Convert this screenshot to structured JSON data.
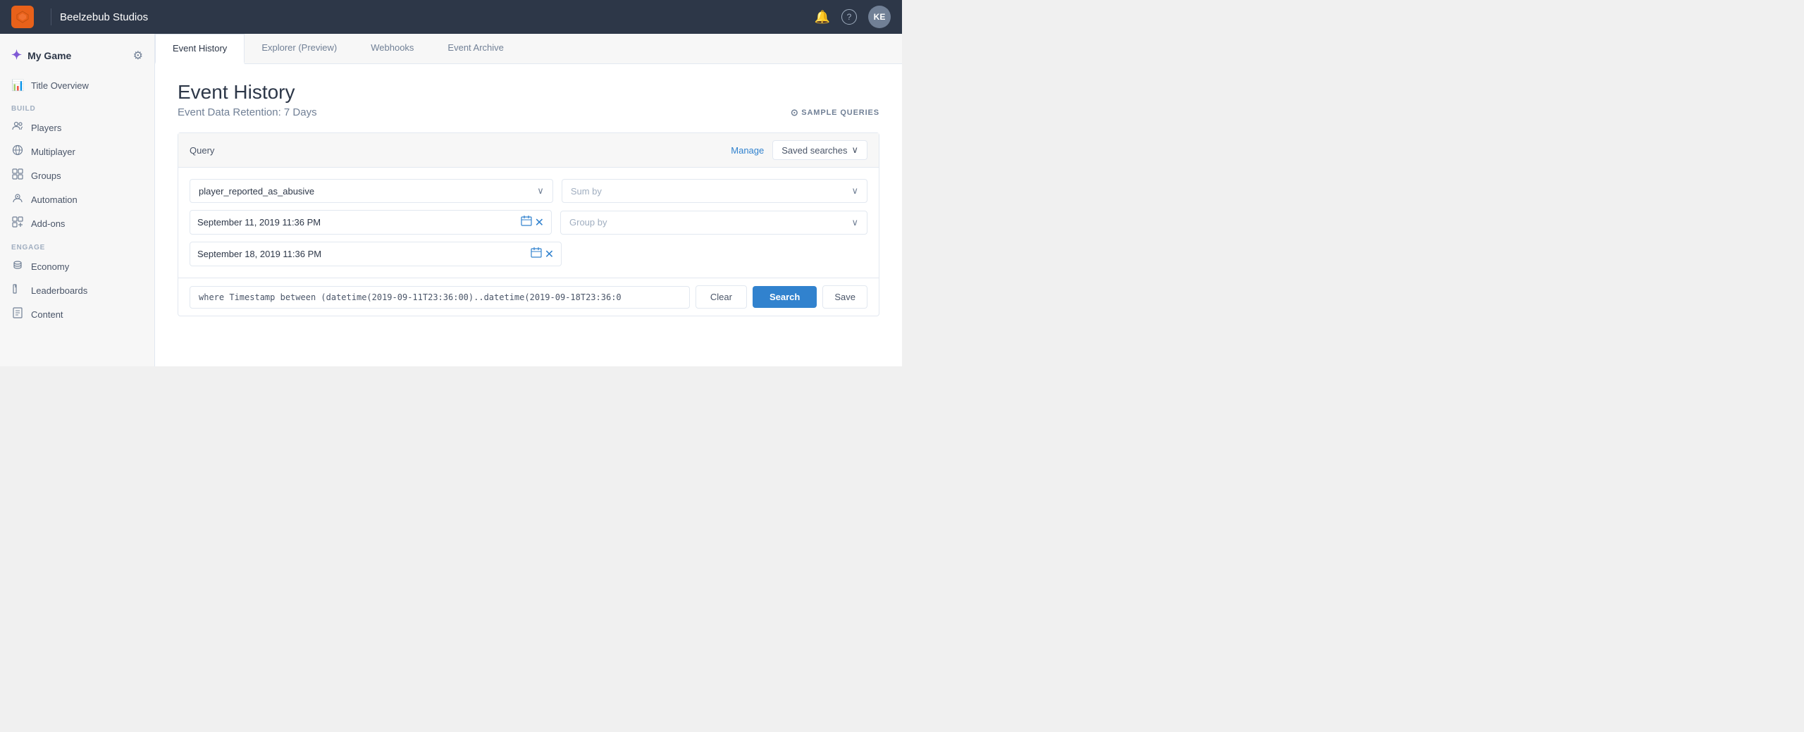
{
  "topnav": {
    "logo_text": "🔥",
    "company_name": "Beelzebub Studios",
    "avatar_initials": "KE",
    "bell_icon": "🔔",
    "help_icon": "?"
  },
  "sidebar": {
    "game_name": "My Game",
    "sections": [
      {
        "label": "",
        "items": [
          {
            "id": "title-overview",
            "label": "Title Overview",
            "icon": "📊"
          }
        ]
      },
      {
        "label": "BUILD",
        "items": [
          {
            "id": "players",
            "label": "Players",
            "icon": "👥"
          },
          {
            "id": "multiplayer",
            "label": "Multiplayer",
            "icon": "🌐"
          },
          {
            "id": "groups",
            "label": "Groups",
            "icon": "▣"
          },
          {
            "id": "automation",
            "label": "Automation",
            "icon": "👤"
          },
          {
            "id": "add-ons",
            "label": "Add-ons",
            "icon": "⊞"
          }
        ]
      },
      {
        "label": "ENGAGE",
        "items": [
          {
            "id": "economy",
            "label": "Economy",
            "icon": "🪙"
          },
          {
            "id": "leaderboards",
            "label": "Leaderboards",
            "icon": "🔖"
          },
          {
            "id": "content",
            "label": "Content",
            "icon": "📄"
          }
        ]
      }
    ]
  },
  "tabs": [
    {
      "id": "event-history",
      "label": "Event History",
      "active": true
    },
    {
      "id": "explorer-preview",
      "label": "Explorer (Preview)",
      "active": false
    },
    {
      "id": "webhooks",
      "label": "Webhooks",
      "active": false
    },
    {
      "id": "event-archive",
      "label": "Event Archive",
      "active": false
    }
  ],
  "page": {
    "title": "Event History",
    "subtitle": "Event Data Retention: 7 Days",
    "sample_queries_label": "⊙ SAMPLE QUERIES"
  },
  "query": {
    "section_label": "Query",
    "manage_label": "Manage",
    "saved_searches_label": "Saved searches",
    "event_selector_value": "player_reported_as_abusive",
    "sum_by_label": "Sum by",
    "start_date": "September 11, 2019 11:36 PM",
    "end_date": "September 18, 2019 11:36 PM",
    "group_by_label": "Group by",
    "query_string": "where Timestamp between (datetime(2019-09-11T23:36:00)..datetime(2019-09-18T23:36:0",
    "clear_label": "Clear",
    "search_label": "Search",
    "save_label": "Save"
  }
}
